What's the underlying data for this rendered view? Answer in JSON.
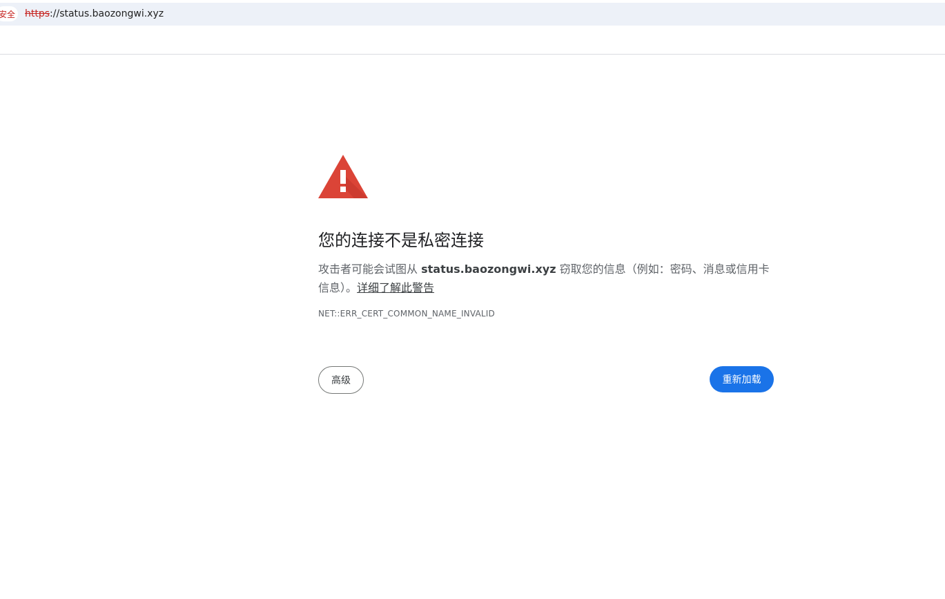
{
  "browser": {
    "security_label": "安全",
    "url_scheme": "https",
    "url_rest": "://status.baozongwi.xyz"
  },
  "interstitial": {
    "icon": "warning-triangle-icon",
    "icon_color": "#db4437",
    "title": "您的连接不是私密连接",
    "desc_prefix": "攻击者可能会试图从 ",
    "host": "status.baozongwi.xyz",
    "desc_suffix": " 窃取您的信息（例如：密码、消息或信用卡信息）。",
    "learn_more": "详细了解此警告",
    "error_code": "NET::ERR_CERT_COMMON_NAME_INVALID",
    "advanced_label": "高级",
    "reload_label": "重新加载",
    "accent_color": "#1a73e8"
  }
}
